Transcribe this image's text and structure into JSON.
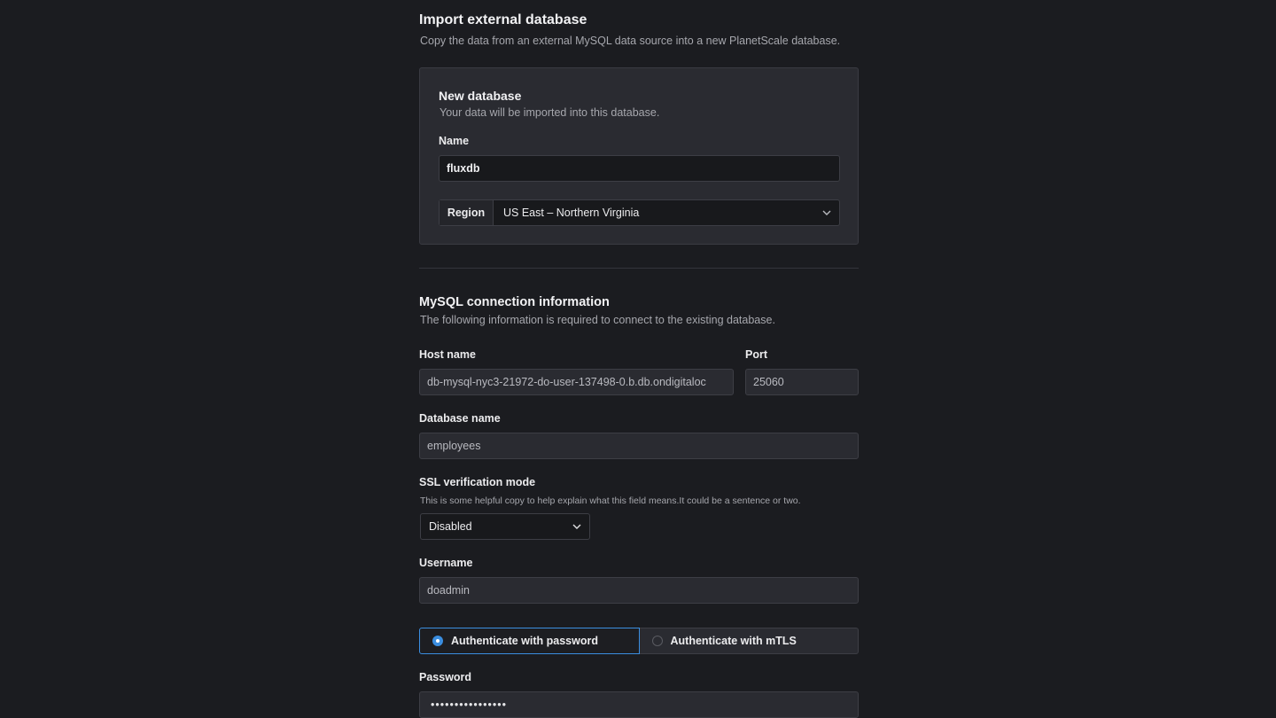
{
  "import": {
    "title": "Import external database",
    "description": "Copy the data from an external MySQL data source into a new PlanetScale database."
  },
  "new_database": {
    "title": "New database",
    "description": "Your data will be imported into this database.",
    "name_label": "Name",
    "name_value": "fluxdb",
    "region_label": "Region",
    "region_value": "US East – Northern Virginia",
    "region_icon": "chevron-down-icon"
  },
  "connection": {
    "title": "MySQL connection information",
    "description": "The following information is required to connect to the existing database.",
    "host_label": "Host name",
    "host_value": "db-mysql-nyc3-21972-do-user-137498-0.b.db.ondigitaloc",
    "port_label": "Port",
    "port_value": "25060",
    "dbname_label": "Database name",
    "dbname_value": "employees",
    "ssl_label": "SSL verification mode",
    "ssl_help": "This is some helpful copy to help explain what this field means.It could be a sentence or two.",
    "ssl_value": "Disabled",
    "ssl_icon": "chevron-down-icon",
    "username_label": "Username",
    "username_value": "doadmin",
    "auth_options": [
      {
        "label": "Authenticate with password",
        "selected": true
      },
      {
        "label": "Authenticate with mTLS",
        "selected": false
      }
    ],
    "password_label": "Password",
    "password_value": "••••••••••••••••"
  },
  "colors": {
    "background": "#1b1c20",
    "card": "#2a2b31",
    "accent": "#3b8ee0"
  }
}
